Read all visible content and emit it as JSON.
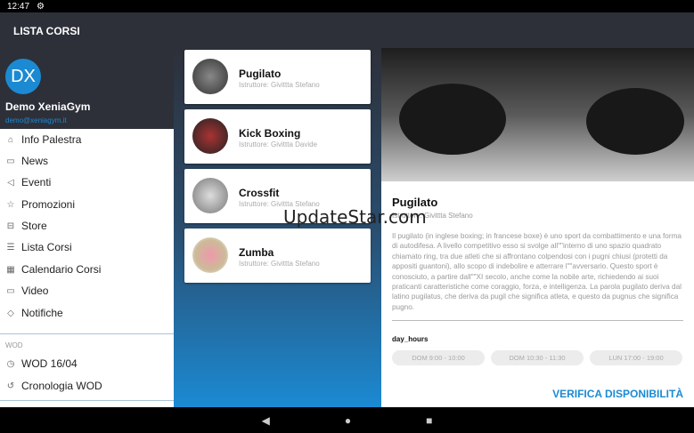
{
  "status": {
    "time": "12:47"
  },
  "appbar": {
    "title": "LISTA CORSI"
  },
  "user": {
    "initials": "DX",
    "name": "Demo XeniaGym",
    "email": "demo@xeniagym.it"
  },
  "menu": [
    {
      "label": "Info Palestra",
      "icon": "home-icon"
    },
    {
      "label": "News",
      "icon": "chat-icon"
    },
    {
      "label": "Eventi",
      "icon": "megaphone-icon"
    },
    {
      "label": "Promozioni",
      "icon": "star-icon"
    },
    {
      "label": "Store",
      "icon": "cart-icon"
    },
    {
      "label": "Lista Corsi",
      "icon": "list-icon"
    },
    {
      "label": "Calendario Corsi",
      "icon": "calendar-icon"
    },
    {
      "label": "Video",
      "icon": "video-icon"
    },
    {
      "label": "Notifiche",
      "icon": "bell-icon"
    }
  ],
  "wod": {
    "section": "WOD",
    "items": [
      {
        "label": "WOD 16/04",
        "icon": "timer-icon"
      },
      {
        "label": "Cronologia WOD",
        "icon": "history-icon"
      }
    ]
  },
  "courses": [
    {
      "name": "Pugilato",
      "instructor": "Istruttore: Givittta Stefano"
    },
    {
      "name": "Kick Boxing",
      "instructor": "Istruttore: Givittta Davide"
    },
    {
      "name": "Crossfit",
      "instructor": "Istruttore: Givittta Stefano"
    },
    {
      "name": "Zumba",
      "instructor": "Istruttore: Givittta Stefano"
    }
  ],
  "detail": {
    "title": "Pugilato",
    "instructor": "Istruttore: Givittta Stefano",
    "description": "Il pugilato (in inglese boxing; in francese boxe) è uno sport da combattimento e una forma di autodifesa. A livello competitivo esso si svolge all\"\"interno di uno spazio quadrato chiamato ring, tra due atleti che si affrontano colpendosi con i pugni chiusi (protetti da appositi guantoni), allo scopo di indebolire e atterrare l\"\"avversario. Questo sport è conosciuto, a partire dall\"\"XI secolo, anche come la nobile arte, richiedendo ai suoi praticanti caratteristiche come coraggio, forza, e intelligenza. La parola pugilato deriva dal latino pugilatus, che deriva da pugil che significa atleta, e questo da pugnus che significa pugno.",
    "hours_label": "day_hours",
    "hours": [
      "DOM 9:00 - 10:00",
      "DOM 10:30 - 11:30",
      "LUN 17:00 - 19:00"
    ],
    "verify": "VERIFICA DISPONIBILITÀ"
  },
  "watermark": "UpdateStar.com",
  "colors": {
    "accent": "#1b8ad3",
    "dark": "#2d3039"
  }
}
